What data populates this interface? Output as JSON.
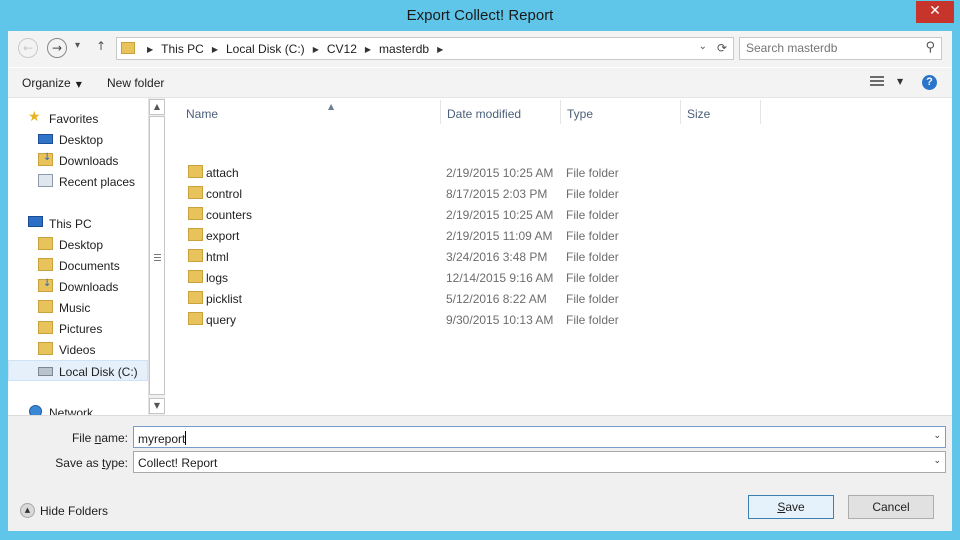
{
  "window": {
    "title": "Export Collect! Report",
    "close_glyph": "✕"
  },
  "nav": {
    "back_glyph": "←",
    "forward_glyph": "→",
    "recent_glyph": "▾",
    "up_glyph": "↑"
  },
  "address": {
    "crumbs": [
      "This PC",
      "Local Disk (C:)",
      "CV12",
      "masterdb"
    ],
    "crumb_sep": "▶",
    "dropdown_glyph": "⌄",
    "refresh_glyph": "⟳"
  },
  "search": {
    "placeholder": "Search masterdb",
    "icon_glyph": "⚲"
  },
  "toolbar": {
    "organize_label": "Organize",
    "organize_arrow": "▼",
    "new_folder_label": "New folder",
    "view_drop": "▼",
    "help_label": "?"
  },
  "sidebar": {
    "items": [
      {
        "label": "Favorites",
        "icon": "star-icon"
      },
      {
        "label": "Desktop",
        "icon": "desktop-icon"
      },
      {
        "label": "Downloads",
        "icon": "downloads-folder-icon"
      },
      {
        "label": "Recent places",
        "icon": "recent-places-icon"
      },
      {
        "label": "This PC",
        "icon": "computer-icon"
      },
      {
        "label": "Desktop",
        "icon": "folder-icon"
      },
      {
        "label": "Documents",
        "icon": "folder-icon"
      },
      {
        "label": "Downloads",
        "icon": "downloads-folder-icon"
      },
      {
        "label": "Music",
        "icon": "folder-icon"
      },
      {
        "label": "Pictures",
        "icon": "folder-icon"
      },
      {
        "label": "Videos",
        "icon": "folder-icon"
      },
      {
        "label": "Local Disk (C:)",
        "icon": "disk-icon",
        "selected": true
      },
      {
        "label": "Network",
        "icon": "network-icon"
      }
    ],
    "scroll_up": "▲",
    "scroll_down": "▼"
  },
  "files": {
    "columns": [
      "Name",
      "Date modified",
      "Type",
      "Size"
    ],
    "sort_glyph": "▲",
    "rows": [
      {
        "name": "attach",
        "date": "2/19/2015 10:25 AM",
        "type": "File folder"
      },
      {
        "name": "control",
        "date": "8/17/2015 2:03 PM",
        "type": "File folder"
      },
      {
        "name": "counters",
        "date": "2/19/2015 10:25 AM",
        "type": "File folder"
      },
      {
        "name": "export",
        "date": "2/19/2015 11:09 AM",
        "type": "File folder"
      },
      {
        "name": "html",
        "date": "3/24/2016 3:48 PM",
        "type": "File folder"
      },
      {
        "name": "logs",
        "date": "12/14/2015 9:16 AM",
        "type": "File folder"
      },
      {
        "name": "picklist",
        "date": "5/12/2016 8:22 AM",
        "type": "File folder"
      },
      {
        "name": "query",
        "date": "9/30/2015 10:13 AM",
        "type": "File folder"
      }
    ]
  },
  "form": {
    "file_name_label_pre": "File ",
    "file_name_label_u": "n",
    "file_name_label_post": "ame:",
    "file_name_value": "myreport",
    "save_type_label_pre": "Save as ",
    "save_type_label_u": "t",
    "save_type_label_post": "ype:",
    "save_type_value": "Collect! Report",
    "combo_arrow": "⌄"
  },
  "footer": {
    "hide_folders_label": "Hide Folders",
    "hide_glyph": "▲",
    "save_label_u": "S",
    "save_label_rest": "ave",
    "cancel_label": "Cancel"
  }
}
